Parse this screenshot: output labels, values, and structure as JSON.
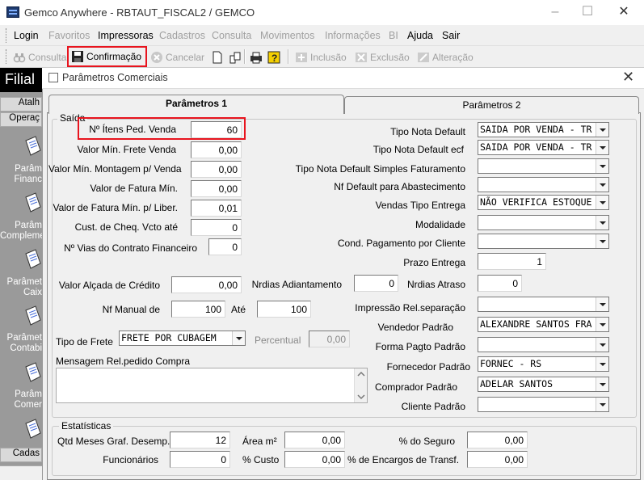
{
  "window": {
    "title": "Gemco Anywhere - RBTAUT_FISCAL2 / GEMCO"
  },
  "menu": [
    "Login",
    "Favoritos",
    "Impressoras",
    "Cadastros",
    "Consulta",
    "Movimentos",
    "Informações",
    "BI",
    "Ajuda",
    "Sair"
  ],
  "toolbar": {
    "consulta": "Consulta",
    "confirmacao": "Confirmação",
    "cancelar": "Cancelar",
    "inclusao": "Inclusão",
    "exclusao": "Exclusão",
    "alteracao": "Alteração"
  },
  "background": {
    "filial": "Filial",
    "tabs": [
      "Atalh",
      "Operaç",
      "Cadas"
    ],
    "items": [
      [
        "Parâm",
        "Financ"
      ],
      [
        "Parâm",
        "Compleme"
      ],
      [
        "Parâmet",
        "Caix"
      ],
      [
        "Parâmet",
        "Contabi"
      ],
      [
        "Parâm",
        "Comer"
      ]
    ]
  },
  "dialog": {
    "title": "Parâmetros Comerciais",
    "tabs": [
      "Parâmetros 1",
      "Parâmetros 2"
    ],
    "saida": {
      "title": "Saída",
      "left_fields": [
        {
          "label": "Nº Ítens Ped. Venda",
          "value": "60"
        },
        {
          "label": "Valor Mín. Frete Venda",
          "value": "0,00"
        },
        {
          "label": "Valor Mín. Montagem p/ Venda",
          "value": "0,00"
        },
        {
          "label": "Valor de Fatura Mín.",
          "value": "0,00"
        },
        {
          "label": "Valor de Fatura Mín. p/ Liber.",
          "value": "0,01"
        },
        {
          "label": "Cust. de Cheq. Vcto até",
          "value": "0"
        },
        {
          "label": "Nº Vias do Contrato Financeiro",
          "value": "0"
        }
      ],
      "valor_alcada": {
        "label": "Valor Alçada de Crédito",
        "value": "0,00"
      },
      "nrdias_adiantamento": {
        "label": "Nrdias Adiantamento",
        "value": "0"
      },
      "nrdias_atraso": {
        "label": "Nrdias Atraso",
        "value": "0"
      },
      "nf_manual": {
        "label": "Nf Manual de",
        "de": "100",
        "ate_label": "Até",
        "ate": "100"
      },
      "tipo_frete": {
        "label": "Tipo de Frete",
        "value": "FRETE POR CUBAGEM"
      },
      "percentual": {
        "label": "Percentual",
        "value": "0,00"
      },
      "mensagem_label": "Mensagem Rel.pedido Compra",
      "right_fields": [
        {
          "label": "Tipo Nota Default",
          "value": "SAIDA POR VENDA - TRIBUT"
        },
        {
          "label": "Tipo Nota Default ecf",
          "value": "SAIDA POR VENDA - TRIBUT"
        },
        {
          "label": "Tipo Nota Default Simples Faturamento",
          "value": ""
        },
        {
          "label": "Nf Default para Abastecimento",
          "value": ""
        },
        {
          "label": "Vendas Tipo Entrega",
          "value": "NÃO VERIFICA ESTOQUE"
        },
        {
          "label": "Modalidade",
          "value": ""
        },
        {
          "label": "Cond. Pagamento por Cliente",
          "value": ""
        }
      ],
      "prazo_entrega": {
        "label": "Prazo Entrega",
        "value": "1"
      },
      "right_fields2": [
        {
          "label": "Impressão Rel.separação",
          "value": ""
        },
        {
          "label": "Vendedor Padrão",
          "value": "ALEXANDRE SANTOS FRAD"
        },
        {
          "label": "Forma Pagto Padrão",
          "value": ""
        },
        {
          "label": "Fornecedor Padrão",
          "value": "FORNEC - RS"
        },
        {
          "label": "Comprador Padrão",
          "value": "ADELAR SANTOS"
        },
        {
          "label": "Cliente Padrão",
          "value": ""
        }
      ]
    },
    "estatisticas": {
      "title": "Estatísticas",
      "qtd_meses": {
        "label": "Qtd Meses Graf. Desemp.",
        "value": "12"
      },
      "funcionarios": {
        "label": "Funcionários",
        "value": "0"
      },
      "area": {
        "label": "Área m²",
        "value": "0,00"
      },
      "custo": {
        "label": "% Custo",
        "value": "0,00"
      },
      "seguro": {
        "label": "% do Seguro",
        "value": "0,00"
      },
      "encargos": {
        "label": "% de Encargos de Transf.",
        "value": "0,00"
      }
    }
  }
}
